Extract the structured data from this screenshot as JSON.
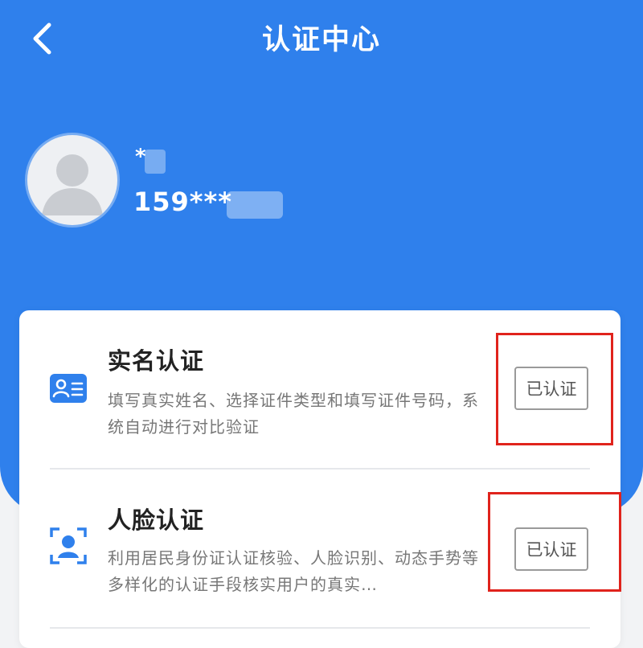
{
  "header": {
    "title": "认证中心",
    "background_color": "#2f80ec"
  },
  "user": {
    "name": "*",
    "phone": "159***"
  },
  "items": [
    {
      "title": "实名认证",
      "description": "填写真实姓名、选择证件类型和填写证件号码，系统自动进行对比验证",
      "status": "已认证",
      "icon": "id-card-icon"
    },
    {
      "title": "人脸认证",
      "description": "利用居民身份证认证核验、人脸识别、动态手势等多样化的认证手段核实用户的真实…",
      "status": "已认证",
      "icon": "face-scan-icon"
    }
  ],
  "colors": {
    "accent": "#2f80ec",
    "highlight": "#e0231c"
  }
}
